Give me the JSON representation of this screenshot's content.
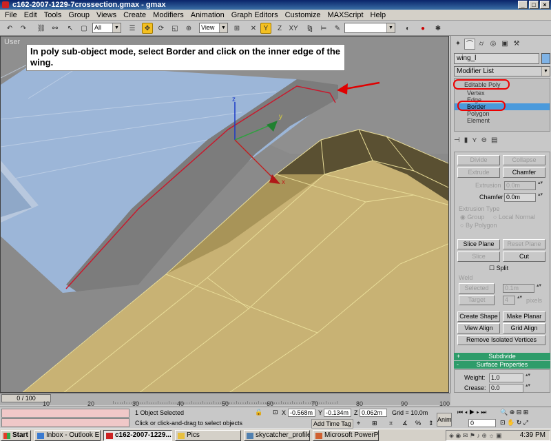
{
  "window": {
    "title": "c162-2007-1229-7crossection.gmax - gmax",
    "controls": [
      "_",
      "□",
      "×"
    ]
  },
  "menu": [
    "File",
    "Edit",
    "Tools",
    "Group",
    "Views",
    "Create",
    "Modifiers",
    "Animation",
    "Graph Editors",
    "Customize",
    "MAXScript",
    "Help"
  ],
  "toolbar": {
    "selection_filter": "All",
    "reference_coord": "View",
    "named_selection": ""
  },
  "viewport": {
    "label": "User",
    "callout": "In poly sub-object mode, select Border and click on the inner edge of the wing.",
    "gizmo": {
      "z": "z",
      "y": "y",
      "x": "x"
    }
  },
  "panel": {
    "object_name": "wing_l",
    "modifier_list": "Modifier List",
    "stack": {
      "top": "Editable Poly",
      "items": [
        "Vertex",
        "Edge",
        "Border",
        "Polygon",
        "Element"
      ],
      "selected": "Border"
    },
    "rollout_top": {
      "divide": "Divide",
      "collapse": "Collapse"
    },
    "extrude": "Extrude",
    "chamfer": "Chamfer",
    "extrusion_label": "Extrusion",
    "extrusion_value": "0.0m",
    "chamfer_label": "Chamfer",
    "chamfer_value": "0.0m",
    "extrusion_type": "Extrusion Type",
    "opt_group": "Group",
    "opt_local": "Local Normal",
    "opt_polygon": "By Polygon",
    "slice_plane": "Slice Plane",
    "reset_plane": "Reset Plane",
    "slice": "Slice",
    "cut": "Cut",
    "split": "Split",
    "weld_title": "Weld",
    "selected": "Selected",
    "selected_value": "0.1m",
    "target": "Target",
    "target_value": "4",
    "pixels": "pixels",
    "create_shape": "Create Shape",
    "make_planar": "Make Planar",
    "view_align": "View Align",
    "grid_align": "Grid Align",
    "remove_isolated": "Remove Isolated Vertices",
    "subdivide": "Subdivide",
    "surface_properties": "Surface Properties",
    "weight_label": "Weight:",
    "weight_value": "1.0",
    "crease_label": "Crease:",
    "crease_value": "0.0"
  },
  "timeline": {
    "slider": "0 / 100",
    "ticks": [
      "10",
      "20",
      "30",
      "40",
      "50",
      "60",
      "70",
      "80",
      "90",
      "100"
    ]
  },
  "status": {
    "objects_selected": "1 Object Selected",
    "prompt": "Click or click-and-drag to select objects",
    "x_label": "X",
    "x_value": "-0.568m",
    "y_label": "Y",
    "y_value": "-0.134m",
    "z_label": "Z",
    "z_value": "0.062m",
    "grid": "Grid = 10.0m",
    "add_time_tag": "Add Time Tag",
    "anim": "Anim",
    "frame": "0"
  },
  "taskbar": {
    "start": "Start",
    "tasks": [
      "Inbox - Outlook E...",
      "c162-2007-1229...",
      "Pics",
      "skycatcher_profile...",
      "Microsoft PowerP..."
    ],
    "active_index": 1,
    "clock": "4:39 PM"
  },
  "colors": {
    "accent_active": "#f4c020",
    "annotation_red": "#e00000",
    "selected_item": "#4a9adc",
    "rollout_green": "#2e9c6a",
    "wing_blue": "#9cb6d8",
    "wing_tan": "#c8b274"
  }
}
